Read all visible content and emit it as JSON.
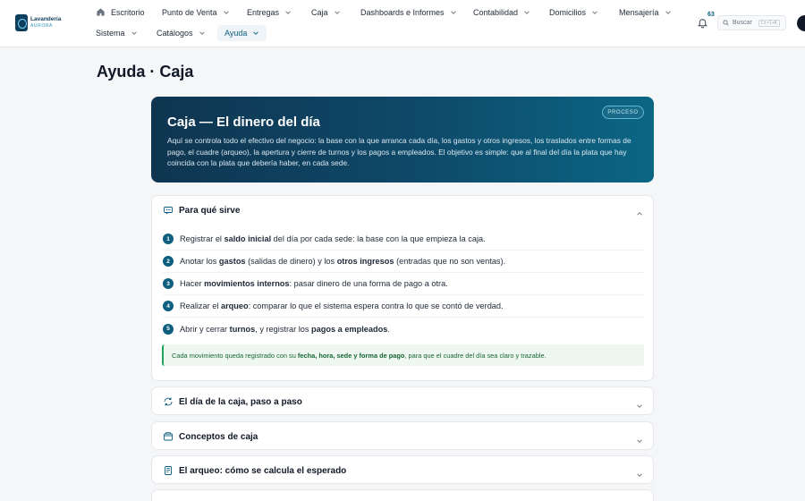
{
  "brand": {
    "name": "Lavandería",
    "sub": "AURORA"
  },
  "nav": {
    "row1": [
      {
        "label": "Escritorio",
        "icon": "home-icon",
        "chevron": false
      },
      {
        "label": "Punto de Venta",
        "chevron": true
      },
      {
        "label": "Entregas",
        "chevron": true
      },
      {
        "label": "Caja",
        "chevron": true
      },
      {
        "label": "Dashboards e Informes",
        "chevron": true
      },
      {
        "label": "Contabilidad",
        "chevron": true
      },
      {
        "label": "Domicilios",
        "chevron": true
      },
      {
        "label": "Mensajería",
        "chevron": true
      }
    ],
    "row2": [
      {
        "label": "Sistema",
        "chevron": true
      },
      {
        "label": "Catálogos",
        "chevron": true
      },
      {
        "label": "Ayuda",
        "chevron": true,
        "active": true
      }
    ],
    "notifications": "63",
    "search": {
      "label": "Buscar",
      "shortcut": "Ctrl+K"
    }
  },
  "page": {
    "title": "Ayuda · Caja"
  },
  "hero": {
    "title": "Caja — El dinero del día",
    "badge": "PROCESO",
    "text": "Aquí se controla todo el efectivo del negocio: la base con la que arranca cada día, los gastos y otros ingresos, los traslados entre formas de pago, el cuadre (arqueo), la apertura y cierre de turnos y los pagos a empleados. El objetivo es simple: que al final del día la plata que hay coincida con la plata que debería haber, en cada sede."
  },
  "sections": {
    "purpose": {
      "title": "Para qué sirve",
      "items": [
        {
          "n": "1",
          "parts": [
            "Registrar el ",
            "saldo inicial",
            " del día por cada sede: la base con la que empieza la caja."
          ]
        },
        {
          "n": "2",
          "parts": [
            "Anotar los ",
            "gastos",
            " (salidas de dinero) y los ",
            "otros ingresos",
            " (entradas que no son ventas)."
          ]
        },
        {
          "n": "3",
          "parts": [
            "Hacer ",
            "movimientos internos",
            ": pasar dinero de una forma de pago a otra."
          ]
        },
        {
          "n": "4",
          "parts": [
            "Realizar el ",
            "arqueo",
            ": comparar lo que el sistema espera contra lo que se contó de verdad."
          ]
        },
        {
          "n": "5",
          "parts": [
            "Abrir y cerrar ",
            "turnos",
            ", y registrar los ",
            "pagos a empleados",
            "."
          ]
        }
      ],
      "note": [
        "Cada movimiento queda registrado con su ",
        "fecha, hora, sede y forma de pago",
        ", para que el cuadre del día sea claro y trazable."
      ]
    },
    "day": {
      "title": "El día de la caja, paso a paso"
    },
    "concepts": {
      "title": "Conceptos de caja"
    },
    "arqueo": {
      "title": "El arqueo: cómo se calcula el esperado"
    }
  },
  "colors": {
    "primary": "#0e5f7f",
    "heroStart": "#0f3550",
    "heroEnd": "#0b6684",
    "noteBorder": "#22a15a"
  }
}
